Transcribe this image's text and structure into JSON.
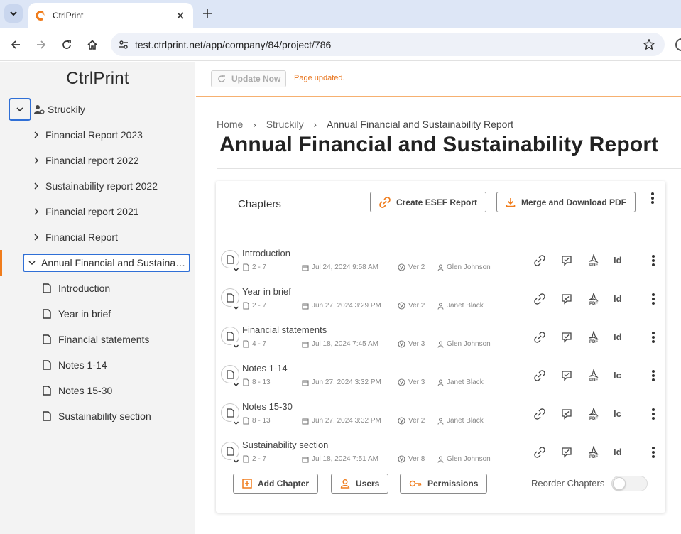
{
  "browser": {
    "tab_title": "CtrlPrint",
    "url": "test.ctrlprint.net/app/company/84/project/786"
  },
  "sidebar": {
    "logo": "CtrlPrint",
    "company": "Struckily",
    "projects": [
      {
        "label": "Financial Report 2023"
      },
      {
        "label": "Financial report 2022"
      },
      {
        "label": "Sustainability report 2022"
      },
      {
        "label": "Financial report 2021"
      },
      {
        "label": "Financial Report"
      }
    ],
    "selected_project": "Annual Financial and Sustainability Report",
    "chapters": [
      {
        "label": "Introduction"
      },
      {
        "label": "Year in brief"
      },
      {
        "label": "Financial statements"
      },
      {
        "label": "Notes 1-14"
      },
      {
        "label": "Notes 15-30"
      },
      {
        "label": "Sustainability section"
      }
    ]
  },
  "topbar": {
    "update_label": "Update Now",
    "status_message": "Page updated."
  },
  "breadcrumb": {
    "home": "Home",
    "company": "Struckily",
    "current": "Annual Financial and Sustainability Report"
  },
  "page_title": "Annual Financial and Sustainability Report",
  "card": {
    "title": "Chapters",
    "esef_label": "Create ESEF Report",
    "merge_label": "Merge and Download PDF",
    "add_chapter_label": "Add Chapter",
    "users_label": "Users",
    "permissions_label": "Permissions",
    "reorder_label": "Reorder Chapters",
    "reorder_enabled": false
  },
  "chapter_rows": [
    {
      "name": "Introduction",
      "pages": "2 - 7",
      "date": "Jul 24, 2024 9:58 AM",
      "version": "Ver 2",
      "user": "Glen Johnson",
      "id_text": "Id"
    },
    {
      "name": "Year in brief",
      "pages": "2 - 7",
      "date": "Jun 27, 2024 3:29 PM",
      "version": "Ver 2",
      "user": "Janet Black",
      "id_text": "Id"
    },
    {
      "name": "Financial statements",
      "pages": "4 - 7",
      "date": "Jul 18, 2024 7:45 AM",
      "version": "Ver 3",
      "user": "Glen Johnson",
      "id_text": "Id"
    },
    {
      "name": "Notes 1-14",
      "pages": "8 - 13",
      "date": "Jun 27, 2024 3:32 PM",
      "version": "Ver 3",
      "user": "Janet Black",
      "id_text": "Ic"
    },
    {
      "name": "Notes 15-30",
      "pages": "8 - 13",
      "date": "Jun 27, 2024 3:32 PM",
      "version": "Ver 2",
      "user": "Janet Black",
      "id_text": "Ic"
    },
    {
      "name": "Sustainability section",
      "pages": "2 - 7",
      "date": "Jul 18, 2024 7:51 AM",
      "version": "Ver 8",
      "user": "Glen Johnson",
      "id_text": "Id"
    }
  ],
  "colors": {
    "brand_orange": "#f07c1b",
    "selection_blue": "#2f6fd6",
    "tabbar_bg": "#dde6f6"
  }
}
